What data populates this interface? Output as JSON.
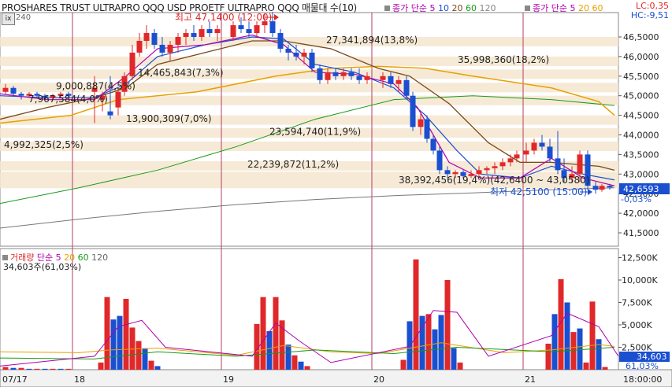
{
  "title": "PROSHARES TRUST ULTRAPRO QQQ USD  PROETF ULTRAPRO QQQ 매물대 수(10)",
  "legend_main": [
    {
      "text": "종가 단순 5",
      "color": "#b000b0"
    },
    {
      "text": "10",
      "color": "#1a4fd0"
    },
    {
      "text": "20",
      "color": "#7a4a1a"
    },
    {
      "text": "60",
      "color": "#1a9a1a"
    },
    {
      "text": "120",
      "color": "#888888"
    }
  ],
  "legend_second": [
    {
      "text": "종가 단순 5",
      "color": "#b000b0"
    },
    {
      "text": "20",
      "color": "#e8a000"
    },
    {
      "text": "60",
      "color": "#e8a000"
    }
  ],
  "lc": "LC:0,35",
  "hc": "HC:-9,51",
  "ix_label": "ix",
  "ix_num": "240",
  "volume_legend": [
    {
      "text": "거래량",
      "color": "#e0282a"
    },
    {
      "text": "단순 5",
      "color": "#b000b0"
    },
    {
      "text": "20",
      "color": "#e8a000"
    },
    {
      "text": "60",
      "color": "#1a9a1a"
    },
    {
      "text": "120",
      "color": "#666666"
    }
  ],
  "volume_pct": "34,603주(61,03%)",
  "high_label": "최고 47,1400 (12:00)",
  "low_label": "최저 42,5100 (15:00)",
  "current_price": "42,6593",
  "current_change": "-0,03%",
  "current_volume": "34,603",
  "current_volume_pct": "61,03%",
  "dates": [
    "07/17",
    "18",
    "19",
    "20",
    "21"
  ],
  "end_time": "18:00:00",
  "price_ticks": [
    "46,5000",
    "46,0000",
    "45,5000",
    "45,0000",
    "44,5000",
    "44,0000",
    "43,5000",
    "43,0000",
    "42,5000",
    "42,0000",
    "41,5000"
  ],
  "volume_ticks": [
    "12,500K",
    "10,000K",
    "7,500K",
    "5,000K",
    "2,500K"
  ],
  "volume_bands": [
    {
      "label": "27,341,894(13,8%)",
      "lo": 46.33,
      "hi": 46.5
    },
    {
      "label": "35,998,360(18,2%)",
      "lo": 45.83,
      "hi": 46.0
    },
    {
      "label": "14,465,843(7,3%)",
      "lo": 45.5,
      "hi": 45.67
    },
    {
      "label": "9,000,887(4,5%)",
      "lo": 45.17,
      "hi": 45.33
    },
    {
      "label": "7,967,584(4,0%)",
      "lo": 44.83,
      "hi": 45.0
    },
    {
      "label": "13,900,309(7,0%)",
      "lo": 44.33,
      "hi": 44.5
    },
    {
      "label": "23,594,740(11,9%)",
      "lo": 44.0,
      "hi": 44.17
    },
    {
      "label": "4,992,325(2,5%)",
      "lo": 43.67,
      "hi": 43.83
    },
    {
      "label": "22,239,872(11,2%)",
      "lo": 43.17,
      "hi": 43.33
    },
    {
      "label": "38,392,456(19,4%)(42,6400 ~ 43,0580)",
      "lo": 42.64,
      "hi": 43.06
    }
  ],
  "colors": {
    "up": "#e0282a",
    "down": "#1a4fd0",
    "band": "#f5e6cf",
    "grid": "#b0406a"
  }
}
